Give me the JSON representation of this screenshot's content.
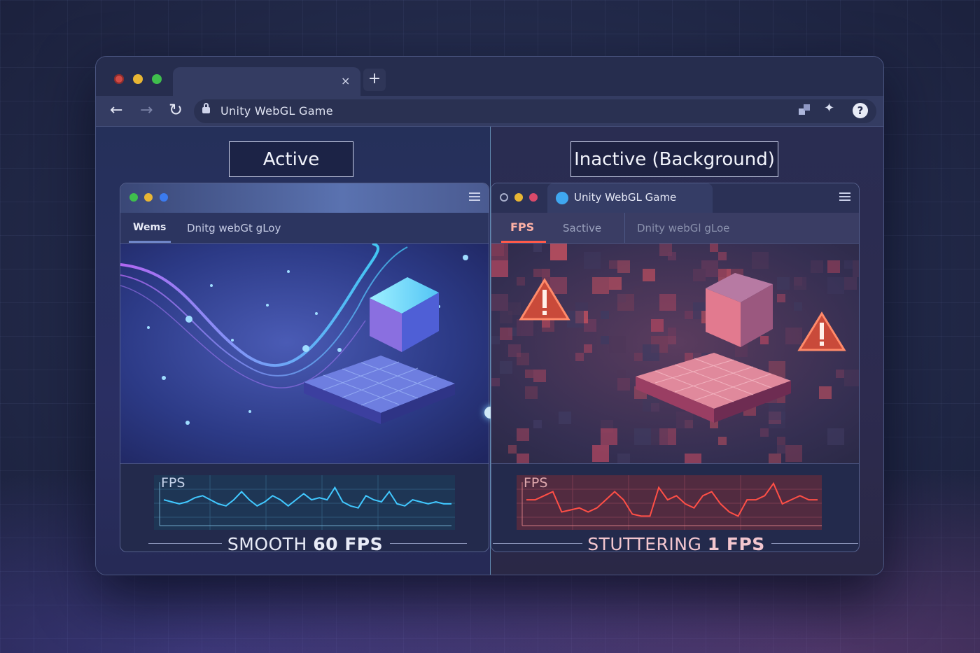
{
  "browser": {
    "tab_close": "×",
    "new_tab": "+",
    "back": "←",
    "forward": "→",
    "reload": "↻",
    "url": "Unity WebGL Game",
    "help": "?"
  },
  "left": {
    "label": "Active",
    "tabs": [
      "Wems",
      "Dnitg webGt gLoy"
    ],
    "graph_label": "FPS",
    "caption_prefix": "SMOOTH",
    "caption_value": "60 FPS",
    "fps_series": [
      12,
      11,
      10,
      11,
      13,
      14,
      12,
      10,
      9,
      12,
      16,
      12,
      9,
      11,
      14,
      12,
      9,
      12,
      15,
      12,
      13,
      12,
      18,
      11,
      9,
      8,
      14,
      12,
      11,
      16,
      10,
      9,
      12,
      11,
      10,
      11,
      10,
      10
    ],
    "accent": "#41c8ff"
  },
  "right": {
    "label": "Inactive (Background)",
    "title": "Unity WebGL Game",
    "tabs": [
      "FPS",
      "Sactive",
      "Dnity webGl gLoe"
    ],
    "graph_label": "FPS",
    "caption_prefix": "STUTTERING",
    "caption_value": "1 FPS",
    "fps_series": [
      12,
      12,
      14,
      16,
      6,
      7,
      8,
      6,
      8,
      12,
      16,
      12,
      5,
      4,
      4,
      18,
      12,
      14,
      10,
      8,
      14,
      16,
      10,
      6,
      4,
      12,
      12,
      14,
      20,
      10,
      12,
      14,
      12,
      12
    ],
    "accent": "#ff4f46"
  }
}
